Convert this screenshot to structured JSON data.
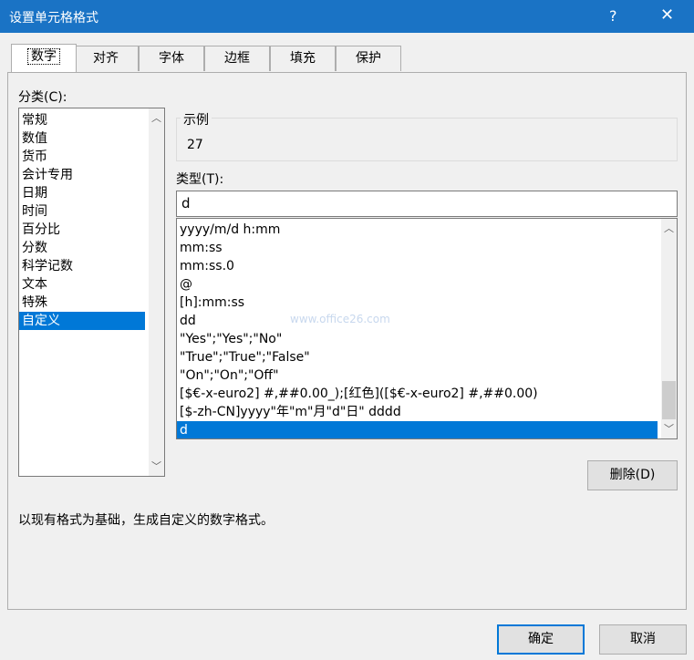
{
  "window": {
    "title": "设置单元格格式",
    "help": "?",
    "close": "✕"
  },
  "tabs": [
    "数字",
    "对齐",
    "字体",
    "边框",
    "填充",
    "保护"
  ],
  "category": {
    "label": "分类(C):",
    "items": [
      "常规",
      "数值",
      "货币",
      "会计专用",
      "日期",
      "时间",
      "百分比",
      "分数",
      "科学记数",
      "文本",
      "特殊",
      "自定义"
    ],
    "selected_index": 11
  },
  "sample": {
    "legend": "示例",
    "value": "27"
  },
  "type": {
    "label": "类型(T):",
    "value": "d",
    "items": [
      "yyyy/m/d h:mm",
      "mm:ss",
      "mm:ss.0",
      "@",
      "[h]:mm:ss",
      "dd",
      "\"Yes\";\"Yes\";\"No\"",
      "\"True\";\"True\";\"False\"",
      "\"On\";\"On\";\"Off\"",
      "[$€-x-euro2] #,##0.00_);[红色]([$€-x-euro2] #,##0.00)",
      "[$-zh-CN]yyyy\"年\"m\"月\"d\"日\" dddd",
      "d"
    ],
    "selected_index": 11
  },
  "buttons": {
    "delete": "删除(D)",
    "ok": "确定",
    "cancel": "取消"
  },
  "description": "以现有格式为基础，生成自定义的数字格式。",
  "watermark": "www.office26.com"
}
